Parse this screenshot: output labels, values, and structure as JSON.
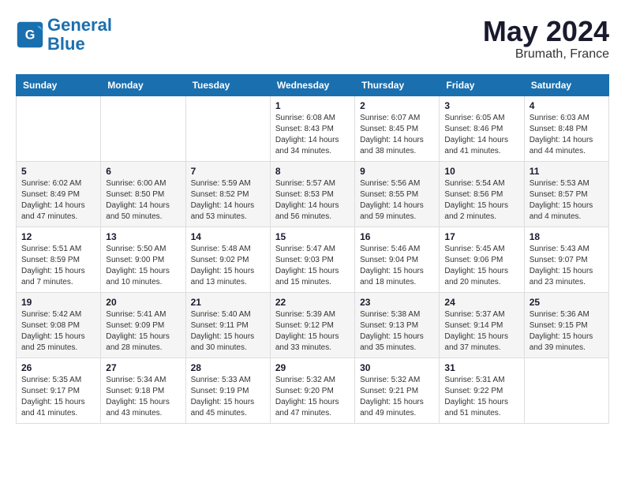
{
  "logo": {
    "text_general": "General",
    "text_blue": "Blue"
  },
  "header": {
    "month_year": "May 2024",
    "location": "Brumath, France"
  },
  "weekdays": [
    "Sunday",
    "Monday",
    "Tuesday",
    "Wednesday",
    "Thursday",
    "Friday",
    "Saturday"
  ],
  "weeks": [
    [
      {
        "day": "",
        "info": ""
      },
      {
        "day": "",
        "info": ""
      },
      {
        "day": "",
        "info": ""
      },
      {
        "day": "1",
        "info": "Sunrise: 6:08 AM\nSunset: 8:43 PM\nDaylight: 14 hours\nand 34 minutes."
      },
      {
        "day": "2",
        "info": "Sunrise: 6:07 AM\nSunset: 8:45 PM\nDaylight: 14 hours\nand 38 minutes."
      },
      {
        "day": "3",
        "info": "Sunrise: 6:05 AM\nSunset: 8:46 PM\nDaylight: 14 hours\nand 41 minutes."
      },
      {
        "day": "4",
        "info": "Sunrise: 6:03 AM\nSunset: 8:48 PM\nDaylight: 14 hours\nand 44 minutes."
      }
    ],
    [
      {
        "day": "5",
        "info": "Sunrise: 6:02 AM\nSunset: 8:49 PM\nDaylight: 14 hours\nand 47 minutes."
      },
      {
        "day": "6",
        "info": "Sunrise: 6:00 AM\nSunset: 8:50 PM\nDaylight: 14 hours\nand 50 minutes."
      },
      {
        "day": "7",
        "info": "Sunrise: 5:59 AM\nSunset: 8:52 PM\nDaylight: 14 hours\nand 53 minutes."
      },
      {
        "day": "8",
        "info": "Sunrise: 5:57 AM\nSunset: 8:53 PM\nDaylight: 14 hours\nand 56 minutes."
      },
      {
        "day": "9",
        "info": "Sunrise: 5:56 AM\nSunset: 8:55 PM\nDaylight: 14 hours\nand 59 minutes."
      },
      {
        "day": "10",
        "info": "Sunrise: 5:54 AM\nSunset: 8:56 PM\nDaylight: 15 hours\nand 2 minutes."
      },
      {
        "day": "11",
        "info": "Sunrise: 5:53 AM\nSunset: 8:57 PM\nDaylight: 15 hours\nand 4 minutes."
      }
    ],
    [
      {
        "day": "12",
        "info": "Sunrise: 5:51 AM\nSunset: 8:59 PM\nDaylight: 15 hours\nand 7 minutes."
      },
      {
        "day": "13",
        "info": "Sunrise: 5:50 AM\nSunset: 9:00 PM\nDaylight: 15 hours\nand 10 minutes."
      },
      {
        "day": "14",
        "info": "Sunrise: 5:48 AM\nSunset: 9:02 PM\nDaylight: 15 hours\nand 13 minutes."
      },
      {
        "day": "15",
        "info": "Sunrise: 5:47 AM\nSunset: 9:03 PM\nDaylight: 15 hours\nand 15 minutes."
      },
      {
        "day": "16",
        "info": "Sunrise: 5:46 AM\nSunset: 9:04 PM\nDaylight: 15 hours\nand 18 minutes."
      },
      {
        "day": "17",
        "info": "Sunrise: 5:45 AM\nSunset: 9:06 PM\nDaylight: 15 hours\nand 20 minutes."
      },
      {
        "day": "18",
        "info": "Sunrise: 5:43 AM\nSunset: 9:07 PM\nDaylight: 15 hours\nand 23 minutes."
      }
    ],
    [
      {
        "day": "19",
        "info": "Sunrise: 5:42 AM\nSunset: 9:08 PM\nDaylight: 15 hours\nand 25 minutes."
      },
      {
        "day": "20",
        "info": "Sunrise: 5:41 AM\nSunset: 9:09 PM\nDaylight: 15 hours\nand 28 minutes."
      },
      {
        "day": "21",
        "info": "Sunrise: 5:40 AM\nSunset: 9:11 PM\nDaylight: 15 hours\nand 30 minutes."
      },
      {
        "day": "22",
        "info": "Sunrise: 5:39 AM\nSunset: 9:12 PM\nDaylight: 15 hours\nand 33 minutes."
      },
      {
        "day": "23",
        "info": "Sunrise: 5:38 AM\nSunset: 9:13 PM\nDaylight: 15 hours\nand 35 minutes."
      },
      {
        "day": "24",
        "info": "Sunrise: 5:37 AM\nSunset: 9:14 PM\nDaylight: 15 hours\nand 37 minutes."
      },
      {
        "day": "25",
        "info": "Sunrise: 5:36 AM\nSunset: 9:15 PM\nDaylight: 15 hours\nand 39 minutes."
      }
    ],
    [
      {
        "day": "26",
        "info": "Sunrise: 5:35 AM\nSunset: 9:17 PM\nDaylight: 15 hours\nand 41 minutes."
      },
      {
        "day": "27",
        "info": "Sunrise: 5:34 AM\nSunset: 9:18 PM\nDaylight: 15 hours\nand 43 minutes."
      },
      {
        "day": "28",
        "info": "Sunrise: 5:33 AM\nSunset: 9:19 PM\nDaylight: 15 hours\nand 45 minutes."
      },
      {
        "day": "29",
        "info": "Sunrise: 5:32 AM\nSunset: 9:20 PM\nDaylight: 15 hours\nand 47 minutes."
      },
      {
        "day": "30",
        "info": "Sunrise: 5:32 AM\nSunset: 9:21 PM\nDaylight: 15 hours\nand 49 minutes."
      },
      {
        "day": "31",
        "info": "Sunrise: 5:31 AM\nSunset: 9:22 PM\nDaylight: 15 hours\nand 51 minutes."
      },
      {
        "day": "",
        "info": ""
      }
    ]
  ]
}
